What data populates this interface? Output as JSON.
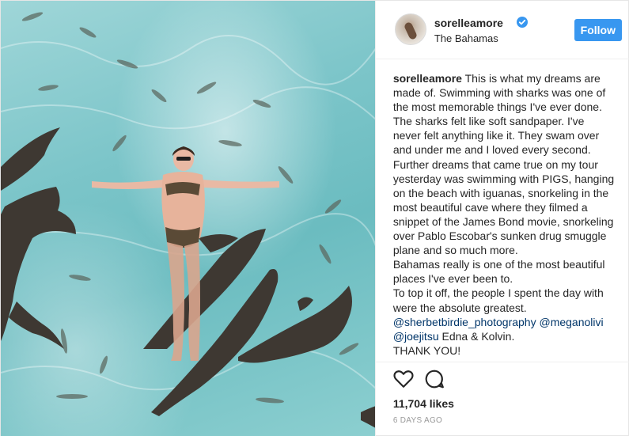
{
  "post": {
    "image_alt": "",
    "author": {
      "username": "sorelleamore",
      "verified": true,
      "location": "The Bahamas"
    },
    "follow_label": "Follow",
    "caption": {
      "username": "sorelleamore",
      "text": "This is what my dreams are made of. Swimming with sharks was one of the most memorable things I've ever done. The sharks felt like soft sandpaper. I've never felt anything like it. They swam over and under me and I loved every second. Further dreams that came true on my tour yesterday was swimming with PIGS, hanging on the beach with iguanas, snorkeling in the most beautiful cave where they filmed a snippet of the James Bond movie, snorkeling over Pablo Escobar's sunken drug smuggle plane and so much more.",
      "line2": "Bahamas really is one of the most beautiful places I've ever been to.",
      "line3": "To top it off, the people I spent the day with were the absolute greatest.",
      "mention1": "@sherbetbirdie_photography",
      "mention2": "@meganolivi",
      "mention3": "@joejitsu",
      "tail": "Edna & Kolvin.",
      "cutoff": "THANK YOU!"
    },
    "likes": "11,704 likes",
    "date": "6 DAYS AGO",
    "colors": {
      "accent": "#3897f0",
      "mention": "#003569",
      "water": "#7cc5c9"
    }
  }
}
